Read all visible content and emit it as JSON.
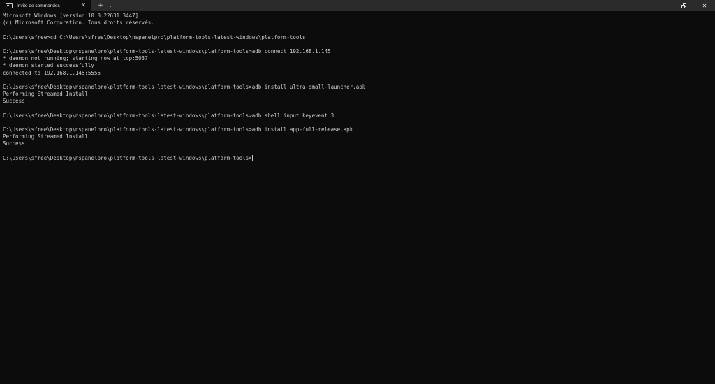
{
  "window": {
    "tab_title": "Invite de commandes",
    "tab_close": "✕",
    "new_tab": "+",
    "tab_dropdown": "⌄",
    "close_symbol": "✕"
  },
  "icons": {
    "tab_icon": "terminal-icon",
    "tab_close": "close-icon",
    "new_tab": "plus-icon",
    "dropdown": "chevron-down-icon",
    "minimize": "minimize-icon",
    "maximize": "restore-icon",
    "close": "close-icon"
  },
  "colors": {
    "background": "#0c0c0c",
    "titlebar": "#2b2b2b",
    "text": "#cccccc"
  },
  "terminal": {
    "lines": [
      "Microsoft Windows [version 10.0.22631.3447]",
      "(c) Microsoft Corporation. Tous droits réservés.",
      "",
      "C:\\Users\\sfree>cd C:\\Users\\sfree\\Desktop\\nspanelpro\\platform-tools-latest-windows\\platform-tools",
      "",
      "C:\\Users\\sfree\\Desktop\\nspanelpro\\platform-tools-latest-windows\\platform-tools>adb connect 192.168.1.145",
      "* daemon not running; starting now at tcp:5037",
      "* daemon started successfully",
      "connected to 192.168.1.145:5555",
      "",
      "C:\\Users\\sfree\\Desktop\\nspanelpro\\platform-tools-latest-windows\\platform-tools>adb install ultra-small-launcher.apk",
      "Performing Streamed Install",
      "Success",
      "",
      "C:\\Users\\sfree\\Desktop\\nspanelpro\\platform-tools-latest-windows\\platform-tools>adb shell input keyevent 3",
      "",
      "C:\\Users\\sfree\\Desktop\\nspanelpro\\platform-tools-latest-windows\\platform-tools>adb install app-full-release.apk",
      "Performing Streamed Install",
      "Success",
      "",
      "C:\\Users\\sfree\\Desktop\\nspanelpro\\platform-tools-latest-windows\\platform-tools>"
    ]
  }
}
